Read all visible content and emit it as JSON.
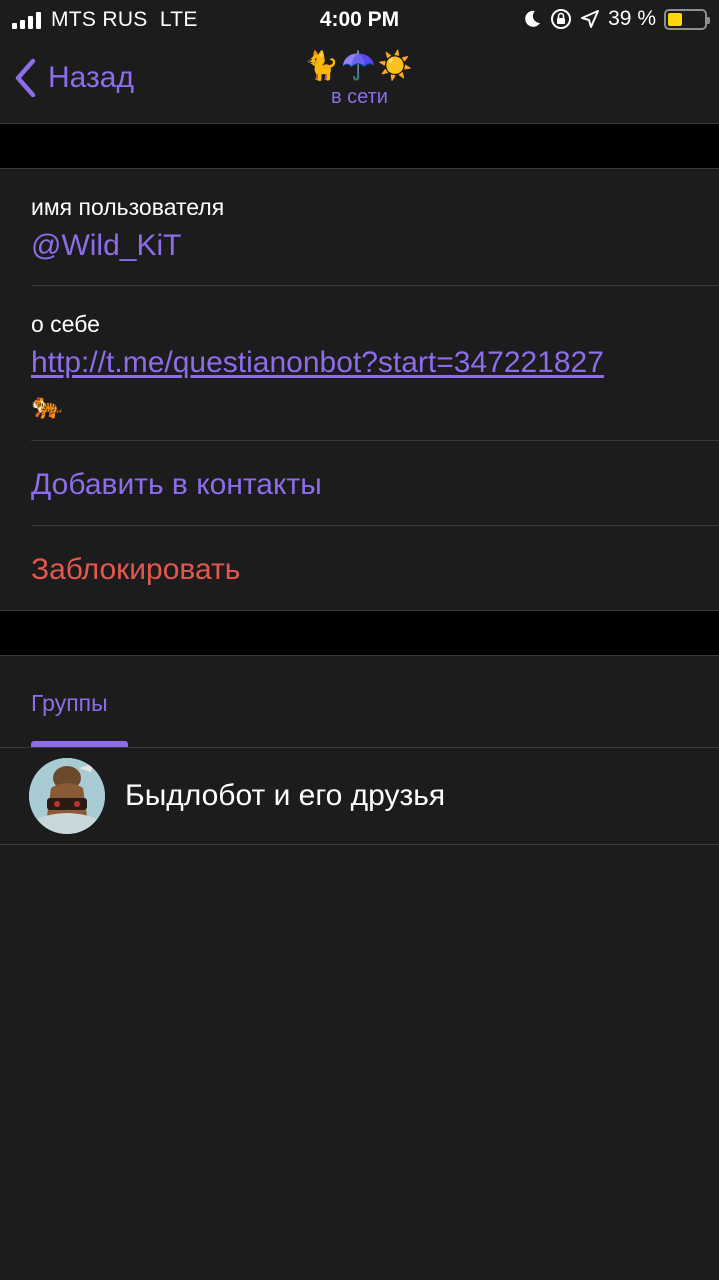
{
  "status_bar": {
    "carrier": "MTS RUS  LTE",
    "time": "4:00 PM",
    "battery_percent": "39 %",
    "battery_level": 0.39,
    "icons": [
      "signal-icon",
      "moon-icon",
      "rotation-lock-icon",
      "location-arrow-icon",
      "battery-icon"
    ]
  },
  "nav": {
    "back_label": "Назад",
    "title_emoji": "🐈☂️☀️",
    "subtitle": "в сети"
  },
  "profile": {
    "username_label": "имя пользователя",
    "username_value": "@Wild_KiT",
    "bio_label": "о себе",
    "bio_link": "http://t.me/questianonbot?start=347221827",
    "bio_emoji": "🐅"
  },
  "actions": {
    "add_contact": "Добавить в контакты",
    "block": "Заблокировать"
  },
  "tabs": {
    "groups": "Группы"
  },
  "groups": [
    {
      "name": "Быдлобот и его друзья"
    }
  ],
  "colors": {
    "accent": "#8e6cea",
    "destructive": "#e5574d",
    "background": "#1c1c1d",
    "separator": "#000000"
  }
}
